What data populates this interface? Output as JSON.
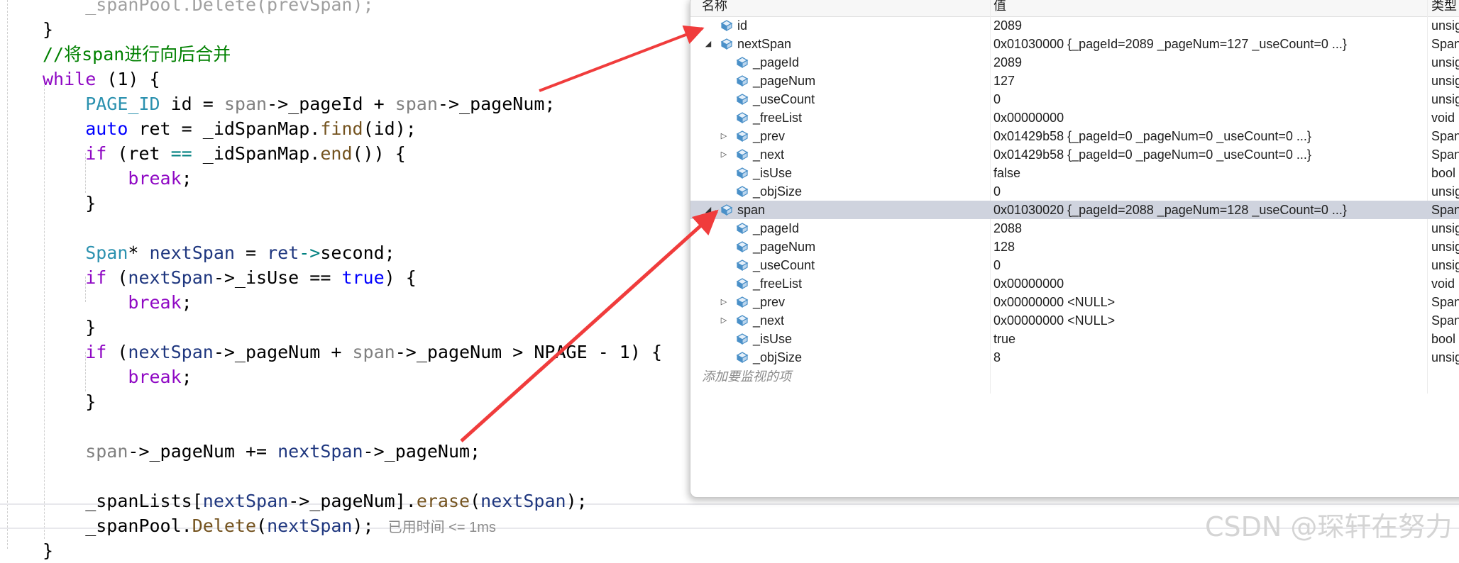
{
  "editor": {
    "lines": [
      {
        "indent": 1,
        "tokens": [
          {
            "t": "_spanPool.Delete(prevSpan);",
            "c": "#a0a0a0"
          }
        ]
      },
      {
        "indent": 0,
        "tokens": [
          {
            "t": "}",
            "c": "#000000"
          }
        ]
      },
      {
        "indent": 0,
        "tokens": [
          {
            "t": "//将span进行向后合并",
            "c": "#008000"
          }
        ]
      },
      {
        "indent": 0,
        "tokens": [
          {
            "t": "while",
            "c": "#8f08c4"
          },
          {
            "t": " (1) {",
            "c": "#000000"
          }
        ]
      },
      {
        "indent": 1,
        "tokens": [
          {
            "t": "PAGE_ID",
            "c": "#2b91af"
          },
          {
            "t": " id = ",
            "c": "#000000"
          },
          {
            "t": "span",
            "c": "#808080"
          },
          {
            "t": "->_pageId + ",
            "c": "#000000"
          },
          {
            "t": "span",
            "c": "#808080"
          },
          {
            "t": "->_pageNum;",
            "c": "#000000"
          }
        ]
      },
      {
        "indent": 1,
        "tokens": [
          {
            "t": "auto",
            "c": "#0000ff"
          },
          {
            "t": " ret = _idSpanMap.",
            "c": "#000000"
          },
          {
            "t": "find",
            "c": "#74531f"
          },
          {
            "t": "(id);",
            "c": "#000000"
          }
        ]
      },
      {
        "indent": 1,
        "tokens": [
          {
            "t": "if",
            "c": "#8f08c4"
          },
          {
            "t": " (ret ",
            "c": "#000000"
          },
          {
            "t": "==",
            "c": "#008080"
          },
          {
            "t": " _idSpanMap.",
            "c": "#000000"
          },
          {
            "t": "end",
            "c": "#74531f"
          },
          {
            "t": "()) {",
            "c": "#000000"
          }
        ]
      },
      {
        "indent": 2,
        "tokens": [
          {
            "t": "break",
            "c": "#8f08c4"
          },
          {
            "t": ";",
            "c": "#000000"
          }
        ]
      },
      {
        "indent": 1,
        "tokens": [
          {
            "t": "}",
            "c": "#000000"
          }
        ]
      },
      {
        "indent": 0,
        "tokens": []
      },
      {
        "indent": 1,
        "tokens": [
          {
            "t": "Span",
            "c": "#2b91af"
          },
          {
            "t": "* ",
            "c": "#000000"
          },
          {
            "t": "nextSpan",
            "c": "#1f377f"
          },
          {
            "t": " = ",
            "c": "#000000"
          },
          {
            "t": "ret",
            "c": "#1f377f"
          },
          {
            "t": "->",
            "c": "#008080"
          },
          {
            "t": "second;",
            "c": "#000000"
          }
        ]
      },
      {
        "indent": 1,
        "tokens": [
          {
            "t": "if",
            "c": "#8f08c4"
          },
          {
            "t": " (",
            "c": "#000000"
          },
          {
            "t": "nextSpan",
            "c": "#1f377f"
          },
          {
            "t": "->_isUse == ",
            "c": "#000000"
          },
          {
            "t": "true",
            "c": "#0000ff"
          },
          {
            "t": ") {",
            "c": "#000000"
          }
        ]
      },
      {
        "indent": 2,
        "tokens": [
          {
            "t": "break",
            "c": "#8f08c4"
          },
          {
            "t": ";",
            "c": "#000000"
          }
        ]
      },
      {
        "indent": 1,
        "tokens": [
          {
            "t": "}",
            "c": "#000000"
          }
        ]
      },
      {
        "indent": 1,
        "tokens": [
          {
            "t": "if",
            "c": "#8f08c4"
          },
          {
            "t": " (",
            "c": "#000000"
          },
          {
            "t": "nextSpan",
            "c": "#1f377f"
          },
          {
            "t": "->_pageNum + ",
            "c": "#000000"
          },
          {
            "t": "span",
            "c": "#808080"
          },
          {
            "t": "->_pageNum > NPAGE - 1) {",
            "c": "#000000"
          }
        ]
      },
      {
        "indent": 2,
        "tokens": [
          {
            "t": "break",
            "c": "#8f08c4"
          },
          {
            "t": ";",
            "c": "#000000"
          }
        ]
      },
      {
        "indent": 1,
        "tokens": [
          {
            "t": "}",
            "c": "#000000"
          }
        ]
      },
      {
        "indent": 0,
        "tokens": []
      },
      {
        "indent": 1,
        "tokens": [
          {
            "t": "span",
            "c": "#808080"
          },
          {
            "t": "->_pageNum += ",
            "c": "#000000"
          },
          {
            "t": "nextSpan",
            "c": "#1f377f"
          },
          {
            "t": "->_pageNum;",
            "c": "#000000"
          }
        ]
      },
      {
        "indent": 0,
        "tokens": []
      },
      {
        "indent": 1,
        "tokens": [
          {
            "t": "_spanLists[",
            "c": "#000000"
          },
          {
            "t": "nextSpan",
            "c": "#1f377f"
          },
          {
            "t": "->_pageNum].",
            "c": "#000000"
          },
          {
            "t": "erase",
            "c": "#74531f"
          },
          {
            "t": "(",
            "c": "#000000"
          },
          {
            "t": "nextSpan",
            "c": "#1f377f"
          },
          {
            "t": ");",
            "c": "#000000"
          }
        ]
      },
      {
        "indent": 1,
        "tokens": [
          {
            "t": "_spanPool.",
            "c": "#000000"
          },
          {
            "t": "Delete",
            "c": "#74531f"
          },
          {
            "t": "(",
            "c": "#000000"
          },
          {
            "t": "nextSpan",
            "c": "#1f377f"
          },
          {
            "t": ");",
            "c": "#000000"
          }
        ],
        "hint": "已用时间 <= 1ms"
      },
      {
        "indent": 0,
        "tokens": [
          {
            "t": "}",
            "c": "#000000"
          }
        ]
      }
    ]
  },
  "watch": {
    "columns": {
      "name": "名称",
      "value": "值",
      "type": "类型"
    },
    "rows": [
      {
        "level": 0,
        "expander": "",
        "name": "id",
        "value": "2089",
        "type": "unsig",
        "selected": false
      },
      {
        "level": 0,
        "expander": "open",
        "name": "nextSpan",
        "value": "0x01030000 {_pageId=2089 _pageNum=127 _useCount=0 ...}",
        "type": "Span",
        "selected": false
      },
      {
        "level": 1,
        "expander": "",
        "name": "_pageId",
        "value": "2089",
        "type": "unsig",
        "selected": false
      },
      {
        "level": 1,
        "expander": "",
        "name": "_pageNum",
        "value": "127",
        "type": "unsig",
        "selected": false
      },
      {
        "level": 1,
        "expander": "",
        "name": "_useCount",
        "value": "0",
        "type": "unsig",
        "selected": false
      },
      {
        "level": 1,
        "expander": "",
        "name": "_freeList",
        "value": "0x00000000",
        "type": "void",
        "selected": false
      },
      {
        "level": 1,
        "expander": "closed",
        "name": "_prev",
        "value": "0x01429b58 {_pageId=0 _pageNum=0 _useCount=0 ...}",
        "type": "Span",
        "selected": false
      },
      {
        "level": 1,
        "expander": "closed",
        "name": "_next",
        "value": "0x01429b58 {_pageId=0 _pageNum=0 _useCount=0 ...}",
        "type": "Span",
        "selected": false
      },
      {
        "level": 1,
        "expander": "",
        "name": "_isUse",
        "value": "false",
        "type": "bool",
        "selected": false
      },
      {
        "level": 1,
        "expander": "",
        "name": "_objSize",
        "value": "0",
        "type": "unsig",
        "selected": false
      },
      {
        "level": 0,
        "expander": "open",
        "name": "span",
        "value": "0x01030020 {_pageId=2088 _pageNum=128 _useCount=0 ...}",
        "type": "Span",
        "selected": true
      },
      {
        "level": 1,
        "expander": "",
        "name": "_pageId",
        "value": "2088",
        "type": "unsig",
        "selected": false
      },
      {
        "level": 1,
        "expander": "",
        "name": "_pageNum",
        "value": "128",
        "type": "unsig",
        "selected": false
      },
      {
        "level": 1,
        "expander": "",
        "name": "_useCount",
        "value": "0",
        "type": "unsig",
        "selected": false
      },
      {
        "level": 1,
        "expander": "",
        "name": "_freeList",
        "value": "0x00000000",
        "type": "void",
        "selected": false
      },
      {
        "level": 1,
        "expander": "closed",
        "name": "_prev",
        "value": "0x00000000 <NULL>",
        "type": "Span",
        "selected": false
      },
      {
        "level": 1,
        "expander": "closed",
        "name": "_next",
        "value": "0x00000000 <NULL>",
        "type": "Span",
        "selected": false
      },
      {
        "level": 1,
        "expander": "",
        "name": "_isUse",
        "value": "true",
        "type": "bool",
        "selected": false
      },
      {
        "level": 1,
        "expander": "",
        "name": "_objSize",
        "value": "8",
        "type": "unsig",
        "selected": false
      }
    ],
    "add_item_placeholder": "添加要监视的项"
  },
  "colors": {
    "annotation_arrow": "#f03c3c",
    "selected_row": "#cfd3de",
    "watch_icon": "#4a90c8"
  },
  "watermark": "CSDN @琛轩在努力"
}
